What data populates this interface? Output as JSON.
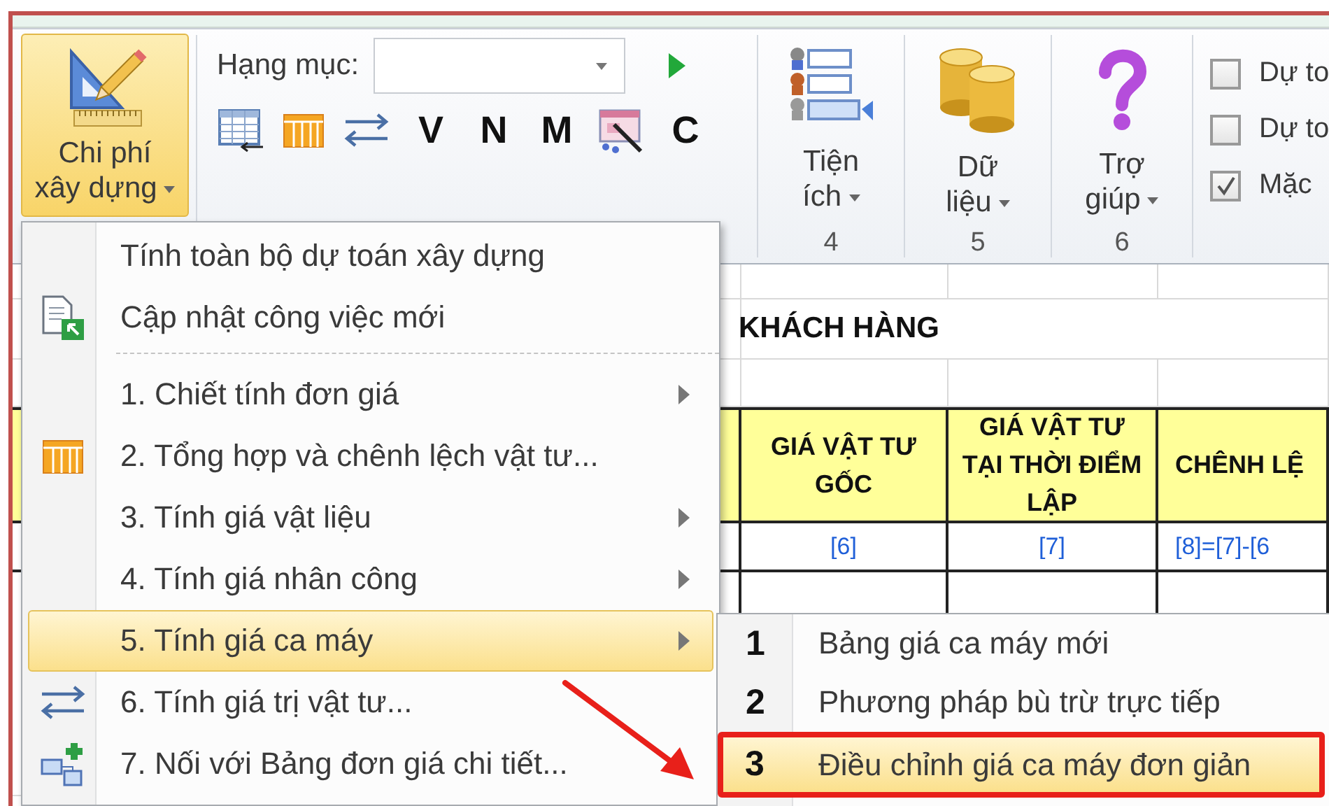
{
  "ribbon": {
    "main_button": {
      "label_lines": [
        "Chi phí",
        "xây dựng"
      ],
      "expanded": true
    },
    "category": {
      "label": "Hạng mục:"
    },
    "tools": [
      {
        "kind": "table"
      },
      {
        "kind": "columns"
      },
      {
        "kind": "swap"
      },
      {
        "kind": "letter",
        "text": "V"
      },
      {
        "kind": "letter",
        "text": "N"
      },
      {
        "kind": "letter",
        "text": "M"
      },
      {
        "kind": "wand"
      },
      {
        "kind": "letter",
        "text": "C"
      }
    ],
    "groups": [
      {
        "kind": "list",
        "label_lines": [
          "Tiện",
          "ích"
        ],
        "number": "4"
      },
      {
        "kind": "database",
        "label_lines": [
          "Dữ",
          "liệu"
        ],
        "number": "5"
      },
      {
        "kind": "help",
        "label_lines": [
          "Trợ",
          "giúp"
        ],
        "number": "6"
      }
    ],
    "options": [
      {
        "label": "Dự to",
        "checked": false
      },
      {
        "label": "Dự to",
        "checked": false
      },
      {
        "label": "Mặc",
        "checked": true
      }
    ]
  },
  "sheet": {
    "title": "KHÁCH HÀNG",
    "headers": [
      "GIÁ VẬT TƯ GỐC",
      "GIÁ VẬT TƯ TẠI THỜI ĐIỂM LẬP",
      "CHÊNH LỆ"
    ],
    "index_row": [
      "[6]",
      "[7]",
      "[8]=[7]-[6"
    ]
  },
  "menu": {
    "items": [
      {
        "kind": "plain",
        "label": "Tính toàn bộ dự toán xây dựng",
        "has_submenu": false,
        "selected": false
      },
      {
        "kind": "document",
        "label": "Cập nhật công việc mới",
        "has_submenu": false,
        "selected": false
      },
      {
        "kind": "separator"
      },
      {
        "kind": "plain",
        "label": "1. Chiết tính đơn giá",
        "has_submenu": true,
        "selected": false
      },
      {
        "kind": "columns",
        "label": "2. Tổng hợp và chênh lệch vật tư...",
        "has_submenu": false,
        "selected": false
      },
      {
        "kind": "plain",
        "label": "3. Tính giá vật liệu",
        "has_submenu": true,
        "selected": false
      },
      {
        "kind": "plain",
        "label": "4. Tính giá nhân công",
        "has_submenu": true,
        "selected": false
      },
      {
        "kind": "plain",
        "label": "5. Tính giá ca máy",
        "has_submenu": true,
        "selected": true
      },
      {
        "kind": "swap",
        "label": "6. Tính giá trị vật tư...",
        "has_submenu": false,
        "selected": false
      },
      {
        "kind": "diagram",
        "label": "7. Nối với Bảng đơn giá chi tiết...",
        "has_submenu": false,
        "selected": false
      }
    ]
  },
  "submenu": {
    "items": [
      {
        "number": "1",
        "label": "Bảng giá ca máy mới",
        "selected": false,
        "highlighted": false
      },
      {
        "number": "2",
        "label": "Phương pháp bù trừ trực tiếp",
        "selected": false,
        "highlighted": false
      },
      {
        "number": "3",
        "label": "Điều chỉnh giá ca máy đơn giản",
        "selected": true,
        "highlighted": true
      }
    ]
  },
  "annotation": {
    "arrow": true
  }
}
